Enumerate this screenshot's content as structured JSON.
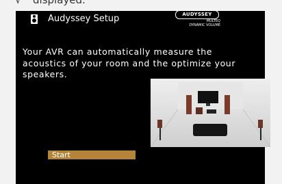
{
  "instruction": {
    "check_mark": "√",
    "text": "displayed."
  },
  "header": {
    "title": "Audyssey Setup",
    "icon": "microphone-icon"
  },
  "logo": {
    "brand": "AUDYSSEY",
    "line1": "MULTEQ",
    "line2": "DYNAMIC VOLUME"
  },
  "description": "Your AVR can automatically measure the acoustics of your room and the optimize your speakers.",
  "start_button": {
    "label": "Start"
  },
  "colors": {
    "screen_bg": "#000000",
    "button_bg": "#b4843a",
    "page_bg": "#f2f2f2",
    "speaker_wood": "#7a3b2a"
  }
}
